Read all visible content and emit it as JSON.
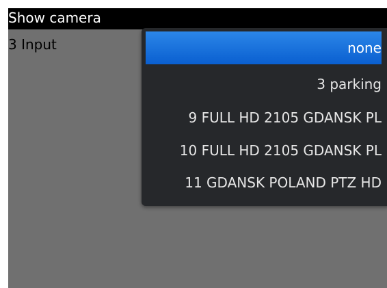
{
  "header": {
    "title": "Show camera"
  },
  "field": {
    "label": "3 Input"
  },
  "dropdown": {
    "selected_index": 0,
    "options": [
      {
        "label": "none"
      },
      {
        "label": "3 parking"
      },
      {
        "label": "9 FULL HD 2105 GDANSK PL"
      },
      {
        "label": "10 FULL HD 2105 GDANSK PL"
      },
      {
        "label": "11 GDANSK POLAND PTZ HD"
      }
    ]
  },
  "colors": {
    "selection_blue": "#1a73e0",
    "menu_background": "#26282b",
    "screen_background": "#707070",
    "title_bar": "#000000"
  }
}
